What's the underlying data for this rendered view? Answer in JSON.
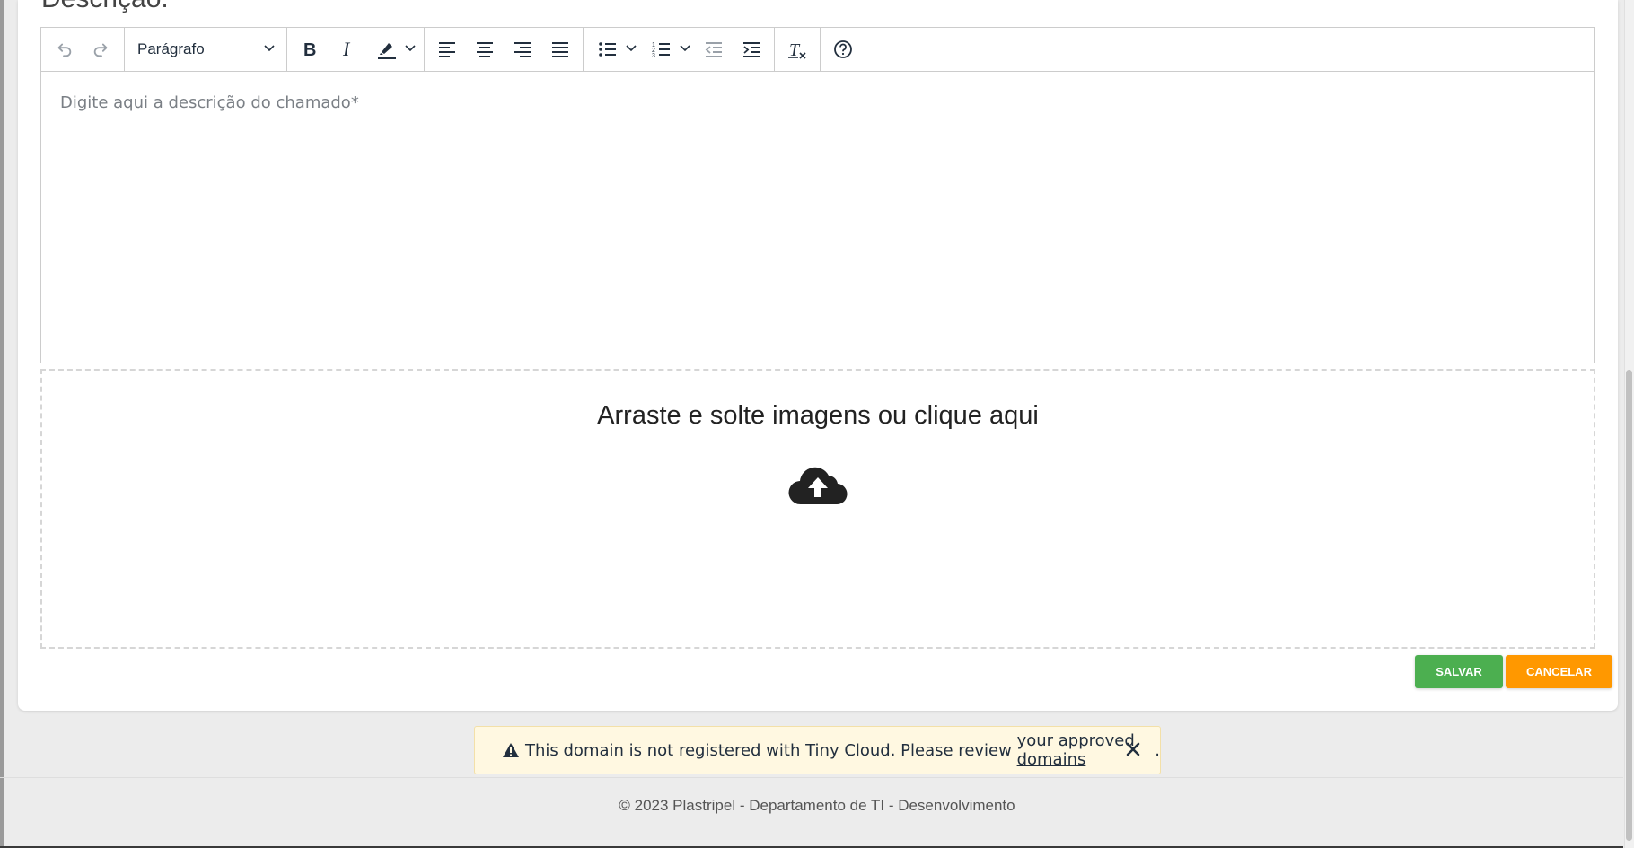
{
  "form": {
    "section_label": "Descrição:"
  },
  "editor": {
    "toolbar": {
      "undo_icon": "undo-icon",
      "redo_icon": "redo-icon",
      "format_select_value": "Parágrafo",
      "bold_icon": "bold-icon",
      "italic_icon": "italic-icon",
      "highlight_icon": "highlight-color-icon",
      "align_left_icon": "align-left-icon",
      "align_center_icon": "align-center-icon",
      "align_right_icon": "align-right-icon",
      "align_justify_icon": "align-justify-icon",
      "bullet_list_icon": "bullet-list-icon",
      "numbered_list_icon": "numbered-list-icon",
      "outdent_icon": "outdent-icon",
      "indent_icon": "indent-icon",
      "clear_format_icon": "clear-formatting-icon",
      "help_icon": "help-icon"
    },
    "placeholder": "Digite aqui a descrição do chamado*"
  },
  "dropzone": {
    "text": "Arraste e solte imagens ou clique aqui",
    "icon": "cloud-upload-icon"
  },
  "actions": {
    "save_label": "SALVAR",
    "cancel_label": "CANCELAR",
    "save_color": "#4caf50",
    "cancel_color": "#ff9800"
  },
  "notice": {
    "text_before": "This domain is not registered with Tiny Cloud. Please review ",
    "link_text": "your approved domains",
    "text_after": ".",
    "warning_icon": "warning-icon",
    "close_icon": "close-icon"
  },
  "footer": {
    "text": "© 2023 Plastripel - Departamento de TI - Desenvolvimento"
  }
}
